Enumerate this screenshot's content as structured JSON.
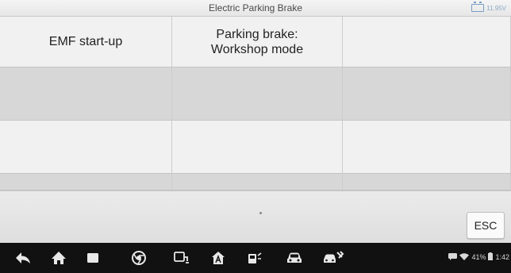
{
  "header": {
    "title": "Electric Parking Brake",
    "battery_voltage": "11.95V"
  },
  "functions": [
    {
      "label": "EMF start-up"
    },
    {
      "label": "Parking brake:\nWorkshop mode"
    }
  ],
  "footer": {
    "esc_label": "ESC"
  },
  "navbar": {
    "icons": [
      "back-icon",
      "home-icon",
      "recent-apps-icon",
      "chrome-icon",
      "vci-icon",
      "autel-home-icon",
      "vehicle-diagnostics-icon",
      "car-icon",
      "service-icon"
    ]
  },
  "status_bar": {
    "battery_percent": "41%",
    "time": "1:42"
  }
}
